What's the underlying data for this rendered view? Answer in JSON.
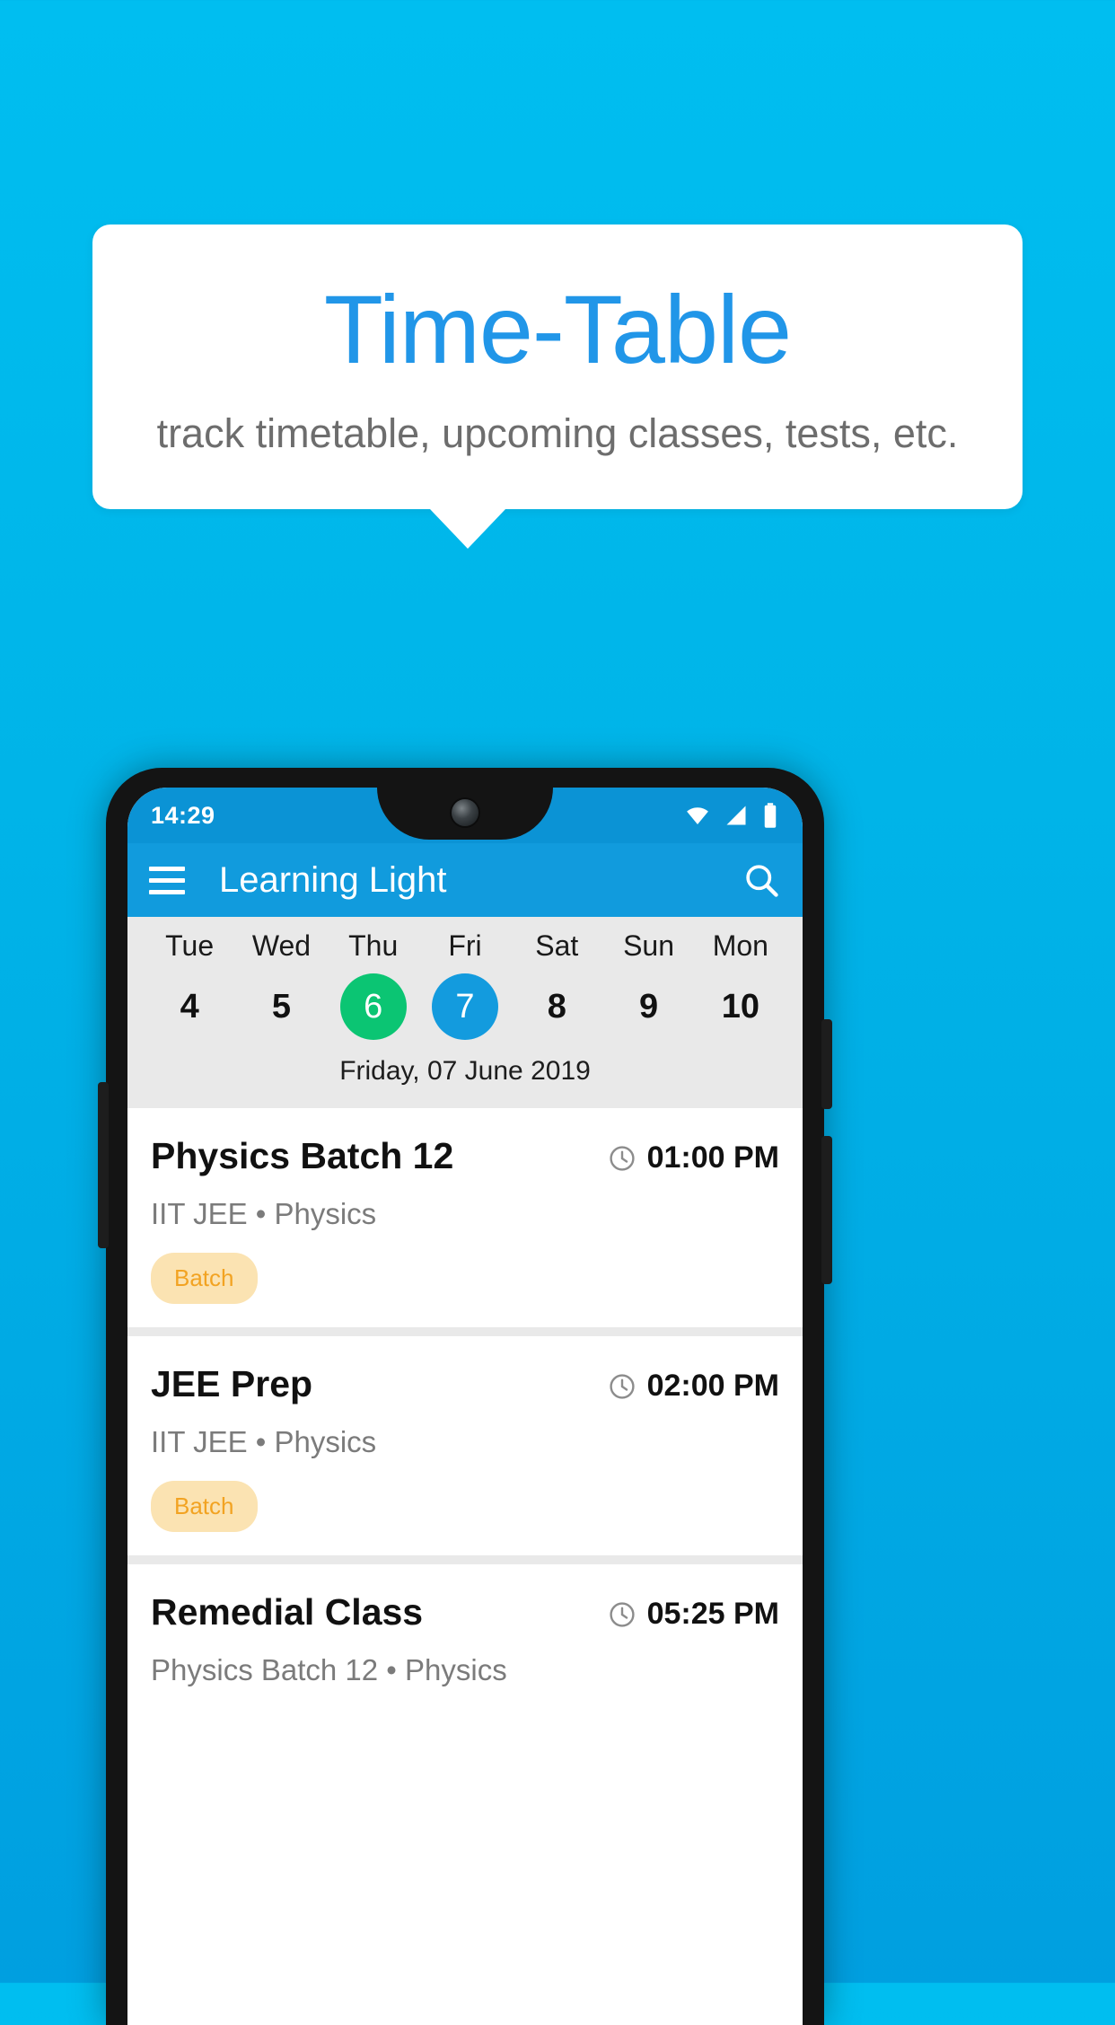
{
  "promo": {
    "title": "Time-Table",
    "subtitle": "track timetable, upcoming classes, tests, etc."
  },
  "phone": {
    "status_bar": {
      "time": "14:29",
      "icons": [
        "wifi-icon",
        "signal-icon",
        "battery-icon"
      ]
    },
    "app_bar": {
      "menu_icon": "hamburger-menu-icon",
      "title": "Learning Light",
      "search_icon": "search-icon"
    },
    "week_strip": {
      "days": [
        {
          "name": "Tue",
          "num": "4",
          "state": "normal"
        },
        {
          "name": "Wed",
          "num": "5",
          "state": "normal"
        },
        {
          "name": "Thu",
          "num": "6",
          "state": "today"
        },
        {
          "name": "Fri",
          "num": "7",
          "state": "selected"
        },
        {
          "name": "Sat",
          "num": "8",
          "state": "normal"
        },
        {
          "name": "Sun",
          "num": "9",
          "state": "normal"
        },
        {
          "name": "Mon",
          "num": "10",
          "state": "normal"
        }
      ],
      "date_label": "Friday, 07 June 2019"
    },
    "schedule": [
      {
        "title": "Physics Batch 12",
        "time": "01:00 PM",
        "subtitle": "IIT JEE • Physics",
        "badge": "Batch"
      },
      {
        "title": "JEE Prep",
        "time": "02:00 PM",
        "subtitle": "IIT JEE • Physics",
        "badge": "Batch"
      },
      {
        "title": "Remedial Class",
        "time": "05:25 PM",
        "subtitle": "Physics Batch 12 • Physics",
        "badge": ""
      }
    ]
  },
  "colors": {
    "background_top": "#00BEF0",
    "accent_blue": "#2196E8",
    "appbar_blue": "#119BDD",
    "today_green": "#0BC573",
    "selected_blue": "#139BDE",
    "badge_bg": "#FBE3B2",
    "badge_text": "#F2A322"
  }
}
